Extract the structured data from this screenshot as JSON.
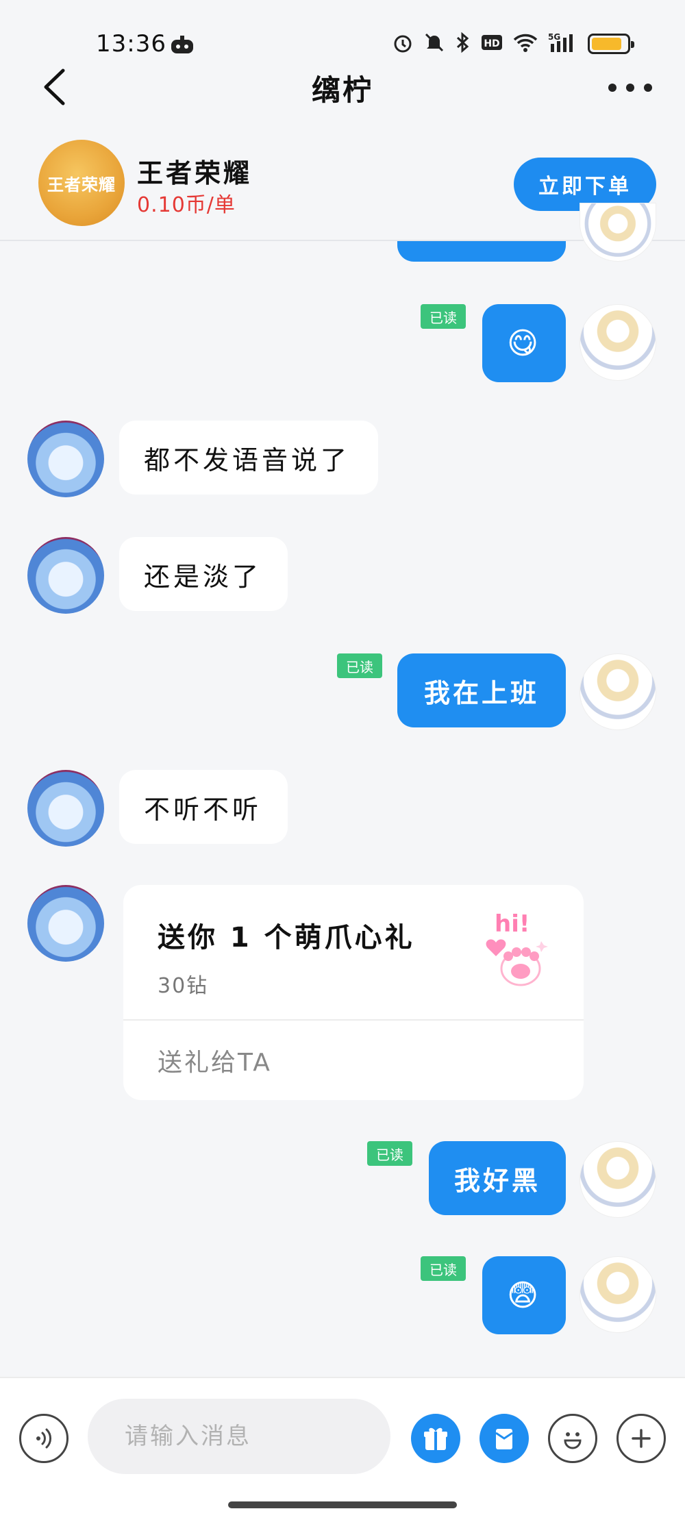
{
  "status_bar": {
    "time": "13:36",
    "network": "5G"
  },
  "header": {
    "title": "缡柠"
  },
  "game": {
    "name": "王者荣耀",
    "logo_text": "王者荣耀",
    "price": "0.10币/单",
    "order_button": "立即下单"
  },
  "messages": {
    "read_label": "已读",
    "m1_emoji": "😋",
    "m2_text": "都不发语音说了",
    "m3_text": "还是淡了",
    "m4_text": "我在上班",
    "m5_text": "不听不听",
    "m6_gift": {
      "title": "送你 1 个萌爪心礼",
      "price": "30钻",
      "action": "送礼给TA"
    },
    "m7_text": "我好黑",
    "m8_emoji": "😨"
  },
  "input": {
    "placeholder": "请输入消息"
  },
  "colors": {
    "accent": "#1f8ef1",
    "read_tag": "#3cc47c",
    "price": "#e53935"
  }
}
